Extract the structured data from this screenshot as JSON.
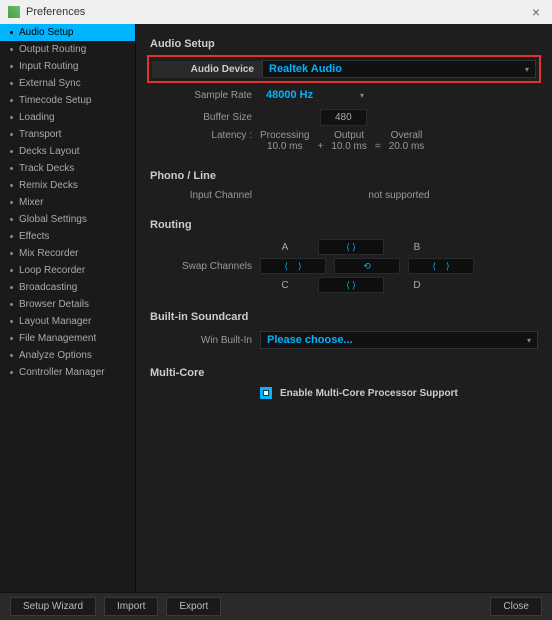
{
  "window": {
    "title": "Preferences"
  },
  "sidebar": {
    "items": [
      {
        "label": "Audio Setup",
        "active": true
      },
      {
        "label": "Output Routing"
      },
      {
        "label": "Input Routing"
      },
      {
        "label": "External Sync"
      },
      {
        "label": "Timecode Setup"
      },
      {
        "label": "Loading"
      },
      {
        "label": "Transport"
      },
      {
        "label": "Decks Layout"
      },
      {
        "label": "Track Decks"
      },
      {
        "label": "Remix Decks"
      },
      {
        "label": "Mixer"
      },
      {
        "label": "Global Settings"
      },
      {
        "label": "Effects"
      },
      {
        "label": "Mix Recorder"
      },
      {
        "label": "Loop Recorder"
      },
      {
        "label": "Broadcasting"
      },
      {
        "label": "Browser Details"
      },
      {
        "label": "Layout Manager"
      },
      {
        "label": "File Management"
      },
      {
        "label": "Analyze Options"
      },
      {
        "label": "Controller Manager"
      }
    ]
  },
  "audio_setup": {
    "title": "Audio Setup",
    "device_label": "Audio Device",
    "device_value": "Realtek Audio",
    "sample_rate_label": "Sample Rate",
    "sample_rate_value": "48000 Hz",
    "buffer_size_label": "Buffer Size",
    "buffer_size_value": "480",
    "latency_label": "Latency :",
    "latency": {
      "processing_label": "Processing",
      "processing_value": "10.0 ms",
      "plus": "+",
      "output_label": "Output",
      "output_value": "10.0 ms",
      "equals": "=",
      "overall_label": "Overall",
      "overall_value": "20.0 ms"
    }
  },
  "phono": {
    "title": "Phono / Line",
    "input_channel_label": "Input Channel",
    "not_supported": "not supported"
  },
  "routing": {
    "title": "Routing",
    "swap_label": "Swap Channels",
    "a": "A",
    "b": "B",
    "c": "C",
    "d": "D"
  },
  "soundcard": {
    "title": "Built-in Soundcard",
    "win_label": "Win Built-In",
    "win_value": "Please choose..."
  },
  "multicore": {
    "title": "Multi-Core",
    "checkbox_label": "Enable Multi-Core Processor Support"
  },
  "footer": {
    "setup_wizard": "Setup Wizard",
    "import": "Import",
    "export": "Export",
    "close": "Close"
  }
}
